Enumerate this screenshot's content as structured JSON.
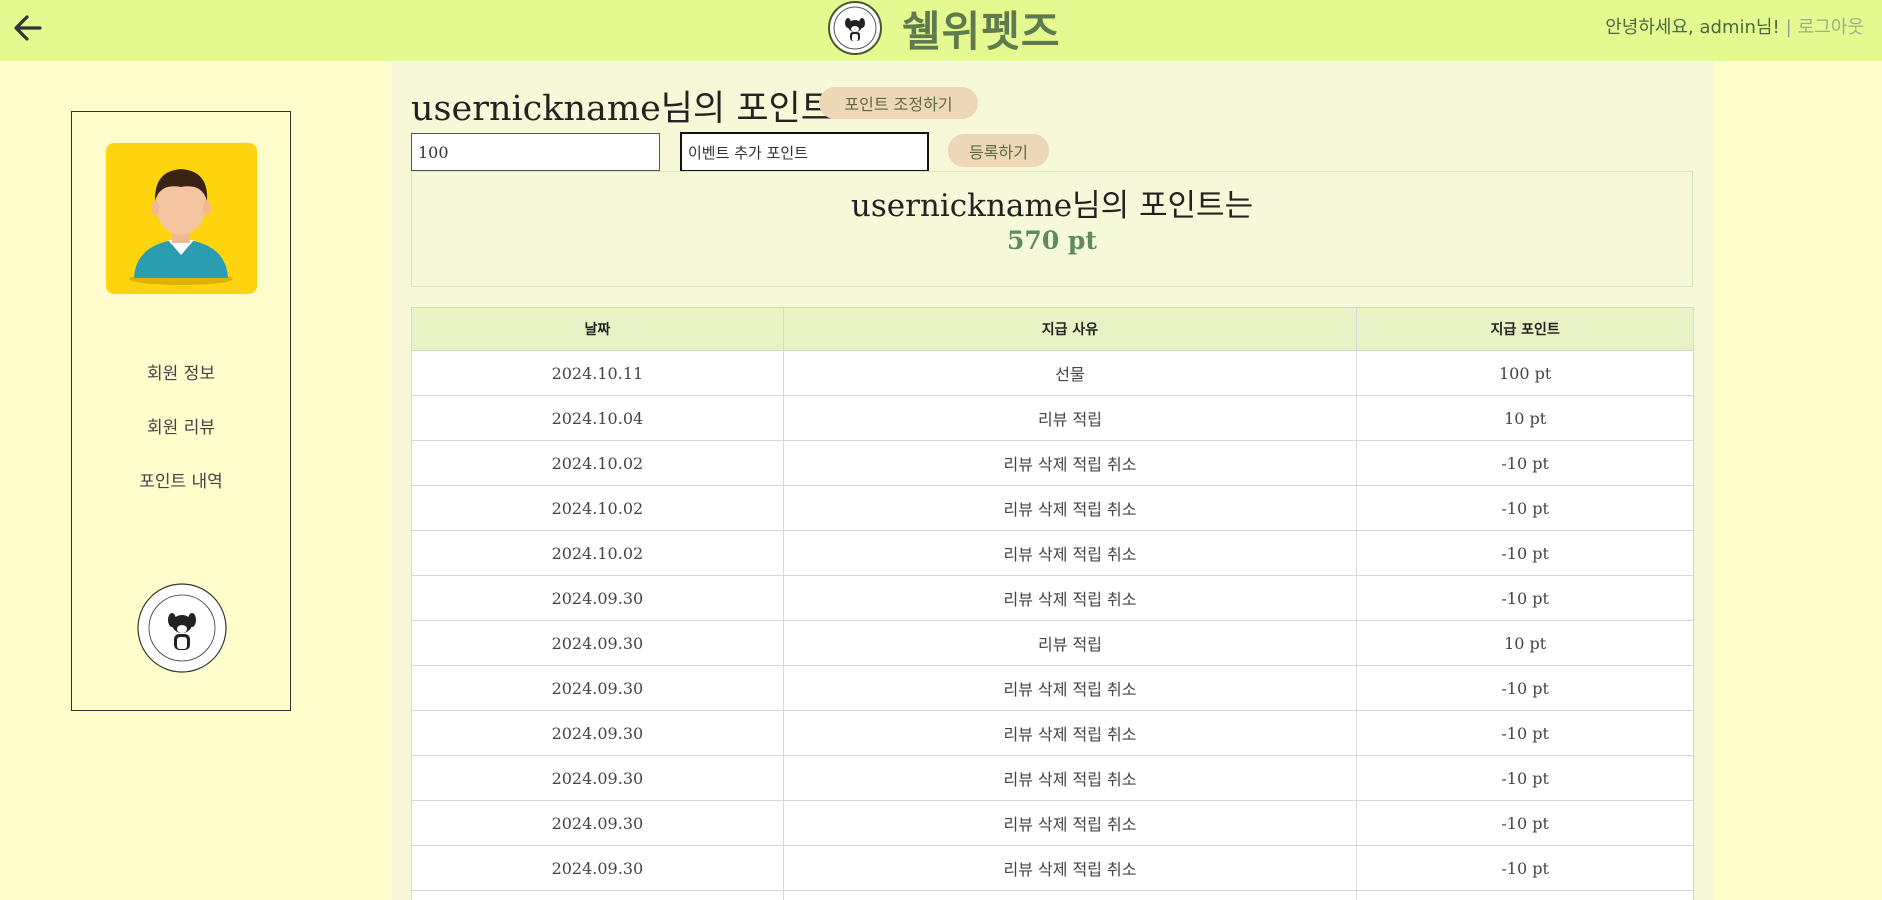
{
  "header": {
    "brand": "쉘위펫즈",
    "greeting": "안녕하세요, admin님!",
    "separator": "|",
    "logout": "로그아웃",
    "bg_color": "#e4f990"
  },
  "sidebar": {
    "menu": [
      {
        "label": "회원 정보"
      },
      {
        "label": "회원 리뷰"
      },
      {
        "label": "포인트 내역"
      }
    ]
  },
  "main": {
    "title": "usernickname님의 포인트",
    "adjust_button": "포인트 조정하기",
    "amount_input_value": "100",
    "reason_input_value": "이벤트 추가 포인트",
    "register_button": "등록하기",
    "summary_label": "usernickname님의 포인트는",
    "summary_value": "570 pt"
  },
  "table": {
    "headers": [
      "날짜",
      "지급 사유",
      "지급 포인트"
    ],
    "rows": [
      [
        "2024.10.11",
        "선물",
        "100 pt"
      ],
      [
        "2024.10.04",
        "리뷰 적립",
        "10 pt"
      ],
      [
        "2024.10.02",
        "리뷰 삭제 적립 취소",
        "-10 pt"
      ],
      [
        "2024.10.02",
        "리뷰 삭제 적립 취소",
        "-10 pt"
      ],
      [
        "2024.10.02",
        "리뷰 삭제 적립 취소",
        "-10 pt"
      ],
      [
        "2024.09.30",
        "리뷰 삭제 적립 취소",
        "-10 pt"
      ],
      [
        "2024.09.30",
        "리뷰 적립",
        "10 pt"
      ],
      [
        "2024.09.30",
        "리뷰 삭제 적립 취소",
        "-10 pt"
      ],
      [
        "2024.09.30",
        "리뷰 삭제 적립 취소",
        "-10 pt"
      ],
      [
        "2024.09.30",
        "리뷰 삭제 적립 취소",
        "-10 pt"
      ],
      [
        "2024.09.30",
        "리뷰 삭제 적립 취소",
        "-10 pt"
      ],
      [
        "2024.09.30",
        "리뷰 삭제 적립 취소",
        "-10 pt"
      ],
      [
        "",
        "",
        ""
      ]
    ]
  },
  "icons": {
    "back": "arrow-left-icon",
    "logo": "dog-logo-icon",
    "avatar": "user-avatar-icon"
  }
}
